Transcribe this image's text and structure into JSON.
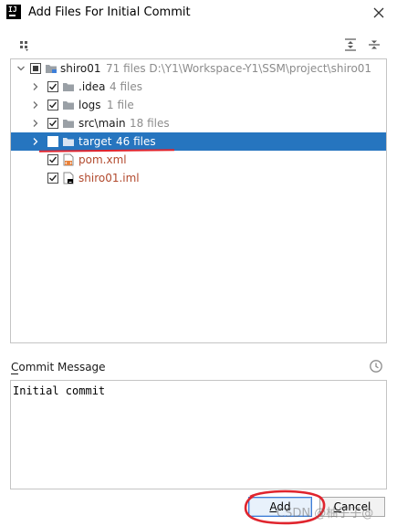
{
  "window": {
    "title": "Add Files For Initial Commit",
    "app_icon_text": "IJ",
    "icons": {
      "close": "close-icon",
      "app": "intellij-icon"
    }
  },
  "toolbar": {
    "icons": [
      "group-by-icon",
      "expand-all-icon",
      "collapse-all-icon"
    ]
  },
  "tree": {
    "rows": [
      {
        "name": "shiro01",
        "meta": "71 files  D:\\Y1\\Workspace-Y1\\SSM\\project\\shiro01",
        "kind": "folder",
        "check": "partial",
        "expanded": true,
        "selected": false
      },
      {
        "name": ".idea",
        "meta": "4 files",
        "kind": "folder",
        "check": "checked",
        "expanded": false,
        "selected": false
      },
      {
        "name": "logs",
        "meta": "1 file",
        "kind": "folder",
        "check": "checked",
        "expanded": false,
        "selected": false
      },
      {
        "name": "src\\main",
        "meta": "18 files",
        "kind": "folder",
        "check": "checked",
        "expanded": false,
        "selected": false
      },
      {
        "name": "target",
        "meta": "46 files",
        "kind": "folder",
        "check": "unchecked",
        "expanded": false,
        "selected": true
      },
      {
        "name": "pom.xml",
        "meta": "",
        "kind": "xml-file",
        "check": "checked",
        "unversioned": true
      },
      {
        "name": "shiro01.iml",
        "meta": "",
        "kind": "iml-file",
        "check": "checked",
        "unversioned": true
      }
    ]
  },
  "commit": {
    "label_mnemonic": "C",
    "label_rest": "ommit Message",
    "message": "Initial commit",
    "history_icon": "history-clock-icon"
  },
  "buttons": {
    "add_mnemonic": "A",
    "add_rest": "dd",
    "cancel_mnemonic": "C",
    "cancel_rest": "ancel"
  },
  "watermark": "CSDN @柚子子@",
  "colors": {
    "selection": "#2675bf",
    "unversioned": "#b24a2e",
    "annotation": "#e0252e"
  }
}
